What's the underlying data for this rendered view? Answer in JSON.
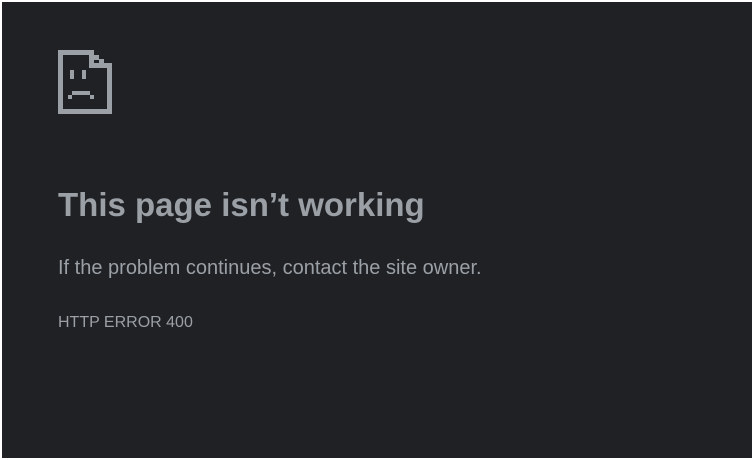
{
  "error_page": {
    "icon": "sad-page-icon",
    "heading": "This page isn’t working",
    "message": "If the problem continues, contact the site owner.",
    "error_code": "HTTP ERROR 400"
  },
  "colors": {
    "background": "#202124",
    "text": "#9aa0a6",
    "icon": "#9aa0a6"
  }
}
